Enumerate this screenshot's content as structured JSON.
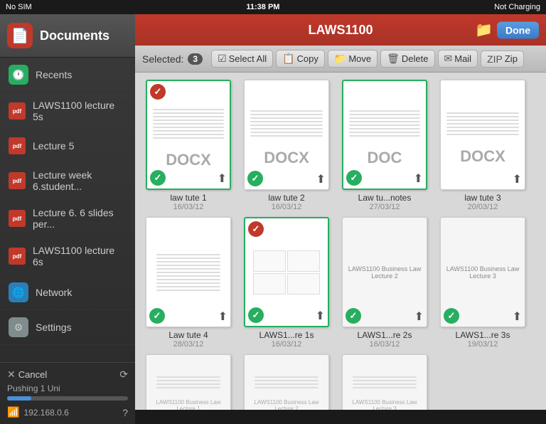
{
  "app": {
    "title": "LAWS1100",
    "done_label": "Done"
  },
  "status_bar": {
    "carrier": "No SIM",
    "time": "11:38 PM",
    "battery": "Not Charging"
  },
  "sidebar": {
    "header": {
      "label": "Documents",
      "icon": "📄"
    },
    "items": [
      {
        "id": "recents",
        "label": "Recents",
        "icon": "🕐",
        "icon_class": "icon-recents"
      },
      {
        "id": "laws1100-5s",
        "label": "LAWS1100 lecture 5s",
        "type": "pdf"
      },
      {
        "id": "lecture5",
        "label": "Lecture 5",
        "type": "pdf"
      },
      {
        "id": "lectureweek6",
        "label": "Lecture week 6.student...",
        "type": "pdf"
      },
      {
        "id": "lecture6slides",
        "label": "Lecture 6. 6 slides per...",
        "type": "pdf"
      },
      {
        "id": "laws1100-6s",
        "label": "LAWS1100 lecture 6s",
        "type": "pdf"
      },
      {
        "id": "network",
        "label": "Network",
        "icon": "🌐",
        "icon_class": "icon-network"
      },
      {
        "id": "settings",
        "label": "Settings",
        "icon": "⚙",
        "icon_class": "icon-settings"
      }
    ],
    "bottom": {
      "cancel_label": "Cancel",
      "pushing_label": "Pushing 1 Uni",
      "progress": 20,
      "ip": "192.168.0.6"
    }
  },
  "toolbar": {
    "selected_label": "Selected:",
    "selected_count": "3",
    "buttons": [
      {
        "id": "select-all",
        "label": "Select All",
        "icon": "☑"
      },
      {
        "id": "copy",
        "label": "Copy",
        "icon": "📋"
      },
      {
        "id": "move",
        "label": "Move",
        "icon": "📁"
      },
      {
        "id": "delete",
        "label": "Delete",
        "icon": "🗑"
      },
      {
        "id": "mail",
        "label": "Mail",
        "icon": "✉"
      },
      {
        "id": "zip",
        "label": "Zip",
        "icon": "📦"
      }
    ]
  },
  "files": [
    {
      "id": "law-tute-1",
      "name": "law tute 1",
      "date": "16/03/12",
      "type": "DOCX",
      "selected": true,
      "checked": true
    },
    {
      "id": "law-tute-2",
      "name": "law tute 2",
      "date": "16/03/12",
      "type": "DOCX",
      "selected": false,
      "checked": true
    },
    {
      "id": "law-tu-notes",
      "name": "Law tu...notes",
      "date": "27/03/12",
      "type": "DOC",
      "selected": true,
      "checked": true
    },
    {
      "id": "law-tute-3",
      "name": "law tute 3",
      "date": "20/03/12",
      "type": "DOCX",
      "selected": false,
      "checked": false
    },
    {
      "id": "law-tute-4",
      "name": "Law tute 4",
      "date": "28/03/12",
      "type": "",
      "selected": false,
      "checked": true
    },
    {
      "id": "laws1-re-1s",
      "name": "LAWS1...re 1s",
      "date": "16/03/12",
      "type": "",
      "selected": true,
      "checked": true
    },
    {
      "id": "laws1-re-2s",
      "name": "LAWS1...re 2s",
      "date": "16/03/12",
      "type": "",
      "selected": false,
      "checked": true
    },
    {
      "id": "laws1-re-3s",
      "name": "LAWS1...re 3s",
      "date": "19/03/12",
      "type": "",
      "selected": false,
      "checked": true
    },
    {
      "id": "bl-1",
      "name": "LAWS1100 Business Law Lecture 1",
      "date": "",
      "type": "",
      "selected": false,
      "checked": false
    },
    {
      "id": "bl-2",
      "name": "LAWS1100 Business Law Lecture 2",
      "date": "",
      "type": "",
      "selected": false,
      "checked": false
    },
    {
      "id": "bl-3",
      "name": "LAWS1100 Business Law Lecture 3",
      "date": "",
      "type": "",
      "selected": false,
      "checked": false
    }
  ]
}
